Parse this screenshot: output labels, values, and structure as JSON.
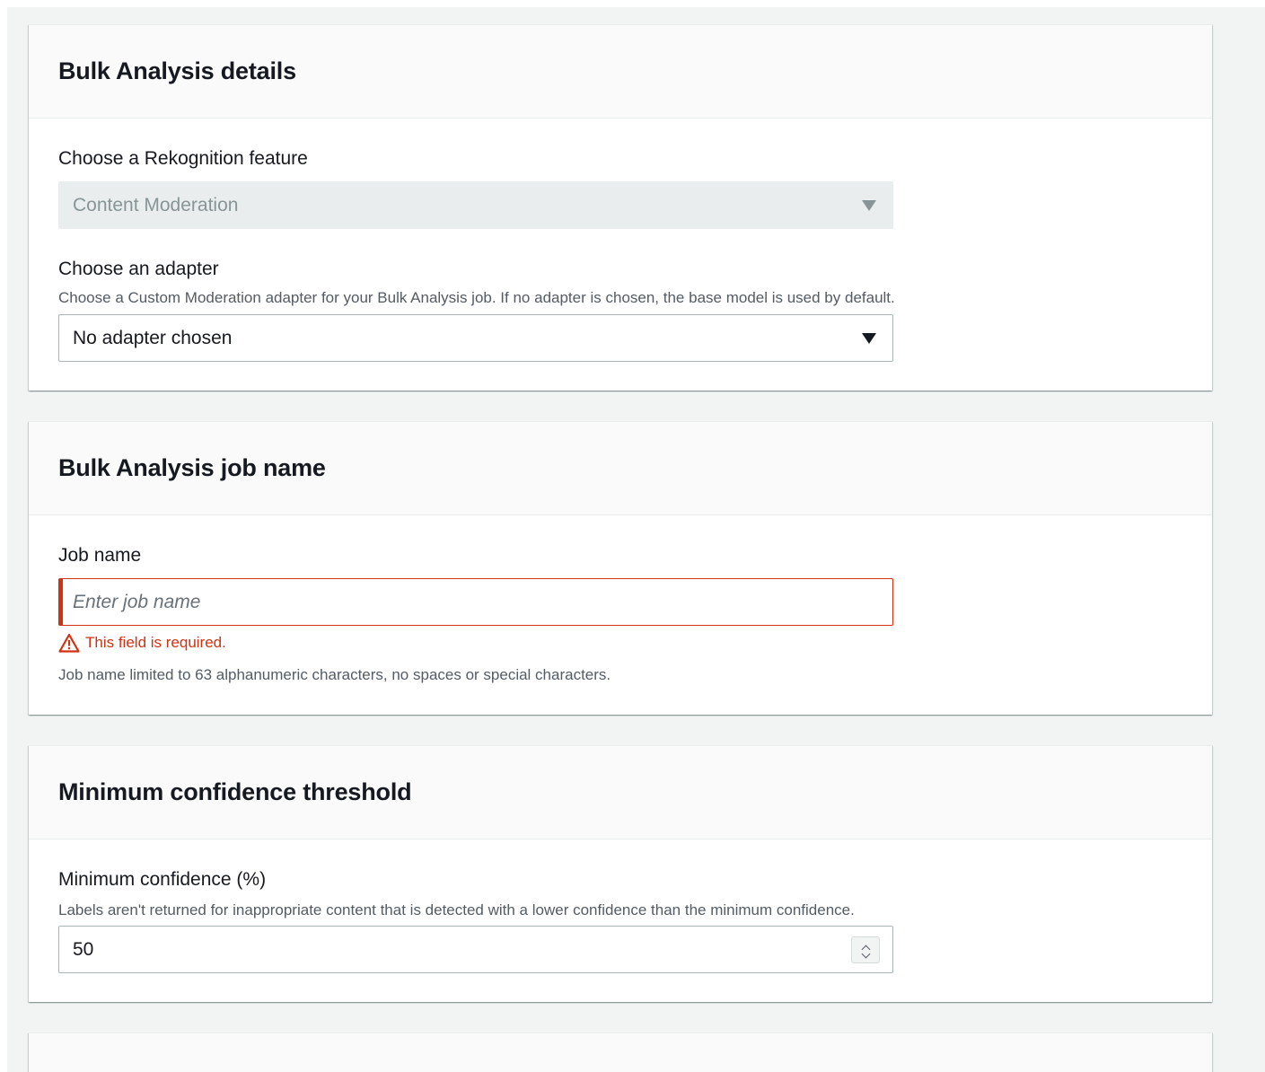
{
  "details_panel": {
    "title": "Bulk Analysis details",
    "feature_label": "Choose a Rekognition feature",
    "feature_value": "Content Moderation",
    "adapter_label": "Choose an adapter",
    "adapter_description": "Choose a Custom Moderation adapter for your Bulk Analysis job. If no adapter is chosen, the base model is used by default.",
    "adapter_value": "No adapter chosen"
  },
  "job_name_panel": {
    "title": "Bulk Analysis job name",
    "job_name_label": "Job name",
    "job_name_placeholder": "Enter job name",
    "job_name_value": "",
    "error_text": "This field is required.",
    "constraint_text": "Job name limited to 63 alphanumeric characters, no spaces or special characters."
  },
  "confidence_panel": {
    "title": "Minimum confidence threshold",
    "confidence_label": "Minimum confidence (%)",
    "confidence_description": "Labels aren't returned for inappropriate content that is detected with a lower confidence than the minimum confidence.",
    "confidence_value": "50"
  },
  "colors": {
    "error": "#d13212",
    "border": "#aab7b8",
    "disabled_bg": "#eaeded",
    "page_bg": "#f2f3f3"
  },
  "icons": {
    "select_caret": "caret-down-icon",
    "error": "warning-triangle-icon",
    "stepper": "chevron-up-down-icon"
  }
}
